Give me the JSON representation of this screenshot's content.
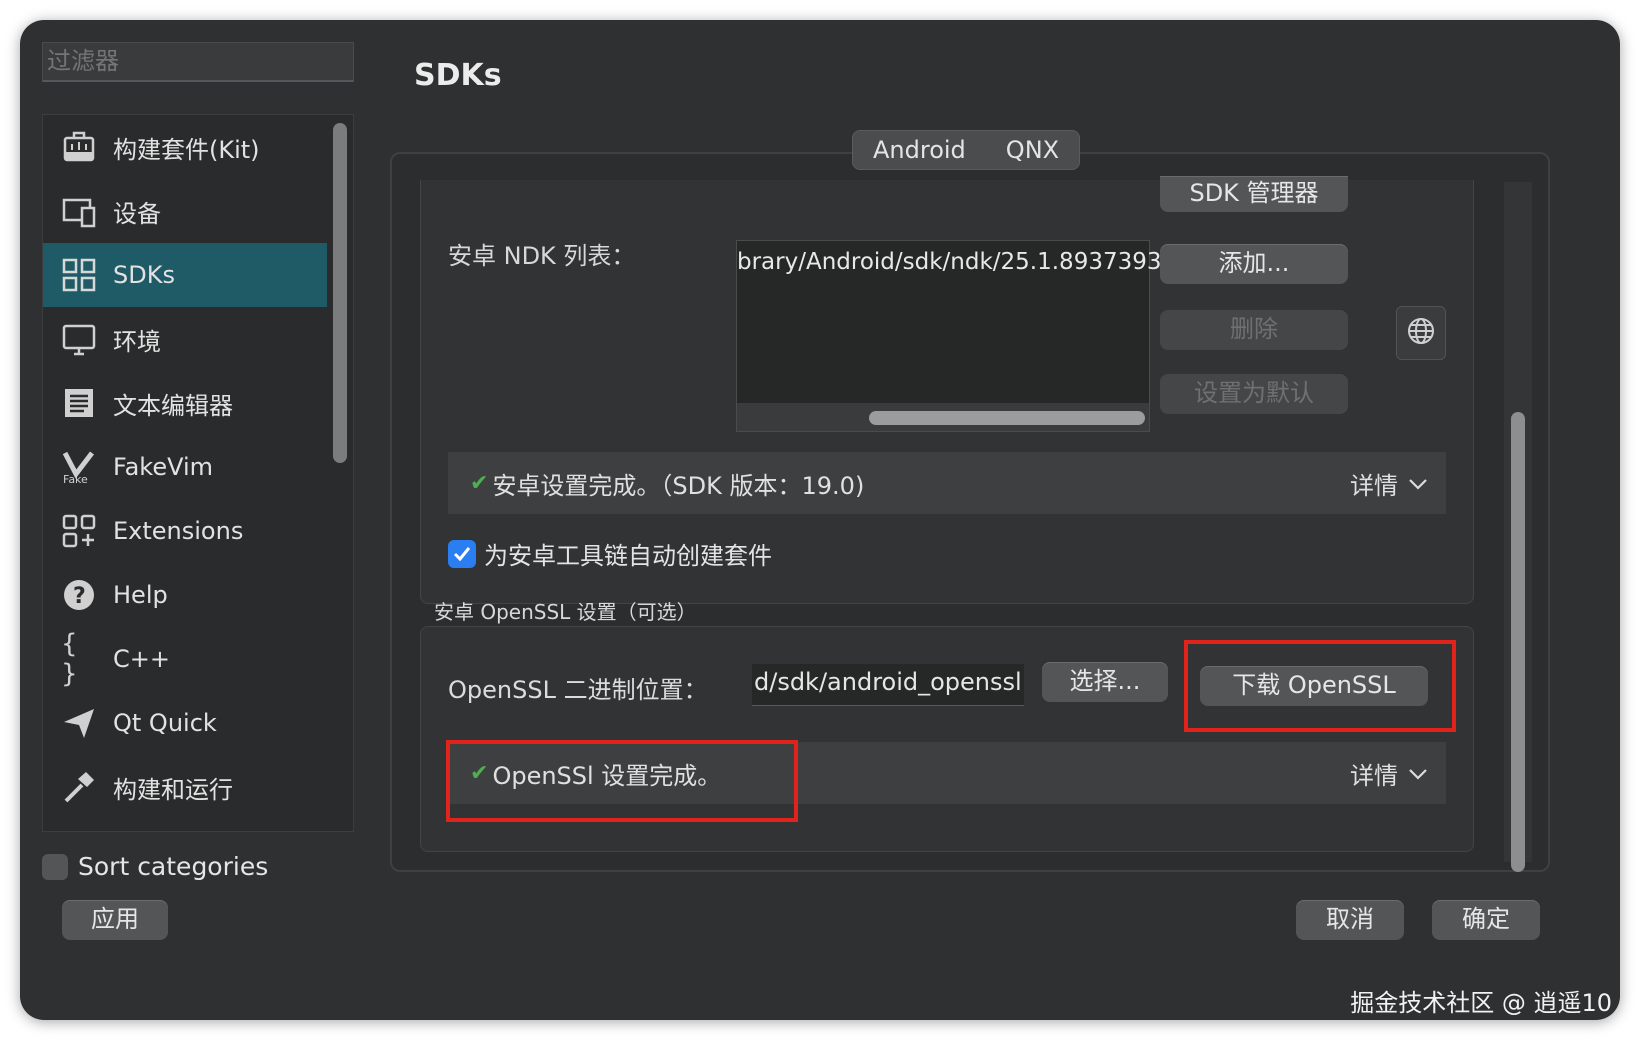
{
  "filter": {
    "placeholder": "过滤器"
  },
  "page_title": "SDKs",
  "sidebar": {
    "items": [
      {
        "label": "构建套件(Kit)",
        "icon": "kit-icon"
      },
      {
        "label": "设备",
        "icon": "device-icon"
      },
      {
        "label": "SDKs",
        "icon": "grid-icon",
        "active": true
      },
      {
        "label": "环境",
        "icon": "monitor-icon"
      },
      {
        "label": "文本编辑器",
        "icon": "text-editor-icon"
      },
      {
        "label": "FakeVim",
        "icon": "fakevim-icon"
      },
      {
        "label": "Extensions",
        "icon": "extensions-icon"
      },
      {
        "label": "Help",
        "icon": "help-icon"
      },
      {
        "label": "C++",
        "icon": "braces-icon"
      },
      {
        "label": "Qt Quick",
        "icon": "qtquick-icon"
      },
      {
        "label": "构建和运行",
        "icon": "hammer-icon"
      }
    ],
    "sort_label": "Sort categories"
  },
  "tabs": [
    "Android",
    "QNX"
  ],
  "android": {
    "sdk_manager_label": "SDK 管理器",
    "ndk_label": "安卓 NDK 列表：",
    "ndk_entry": "brary/Android/sdk/ndk/25.1.8937393",
    "add_label": "添加...",
    "delete_label": "删除",
    "set_default_label": "设置为默认",
    "status_text": "安卓设置完成。（SDK 版本：19.0)",
    "details_label": "详情",
    "auto_kit_label": "为安卓工具链自动创建套件"
  },
  "openssl": {
    "section_title": "安卓 OpenSSL 设置（可选）",
    "location_label": "OpenSSL 二进制位置：",
    "location_value": "d/sdk/android_openssl",
    "choose_label": "选择...",
    "download_label": "下载 OpenSSL",
    "status_text": "OpenSSl 设置完成。",
    "details_label": "详情"
  },
  "footer": {
    "apply_label": "应用",
    "cancel_label": "取消",
    "ok_label": "确定"
  },
  "watermark": "掘金技术社区 @ 逍遥10",
  "colors": {
    "accent": "#1f5a67",
    "highlight": "#e0241c",
    "check": "#4caf50",
    "checkbox": "#2a7ef2"
  }
}
